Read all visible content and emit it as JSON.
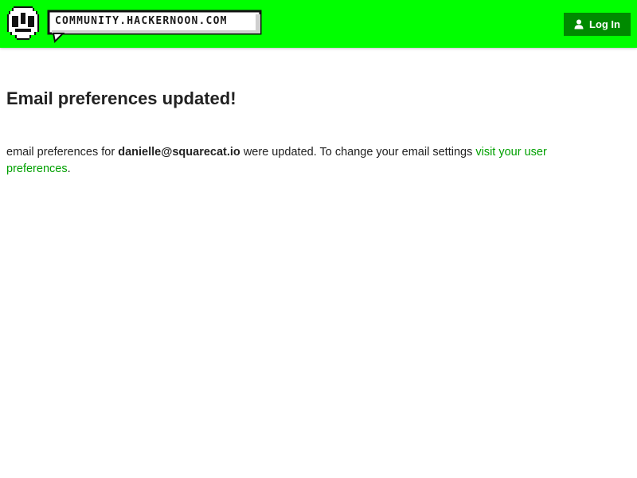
{
  "header": {
    "logo_text": "COMMUNITY.HACKERNOON.COM",
    "login_label": "Log In",
    "login_icon": "user-icon",
    "background_color": "#00ff00",
    "button_color": "#008a00"
  },
  "main": {
    "title": "Email preferences updated!",
    "message_prefix": "email preferences for ",
    "email": "danielle@squarecat.io",
    "message_middle": " were updated. To change your email settings ",
    "link_text": "visit your user preferences",
    "message_suffix": ".",
    "link_color": "#00a000"
  }
}
